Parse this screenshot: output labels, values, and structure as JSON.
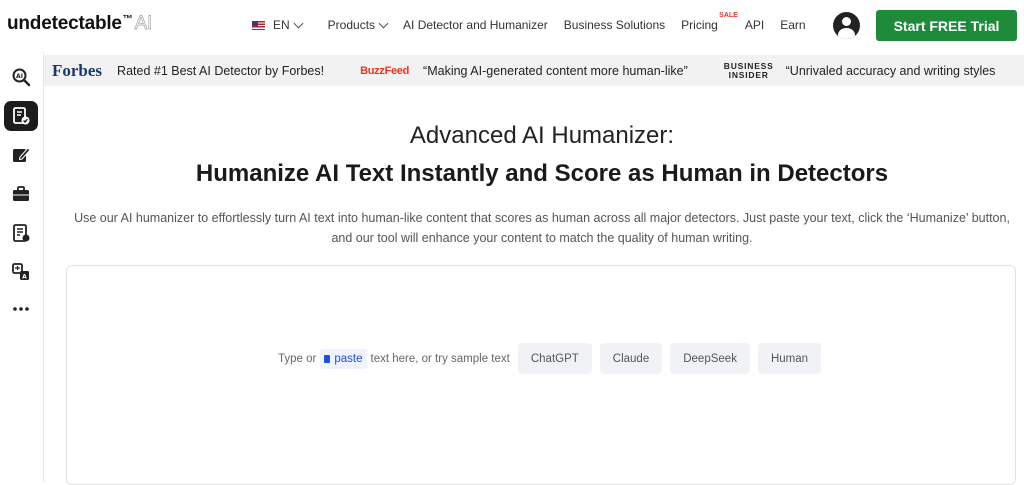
{
  "brand": {
    "name": "undetectable",
    "tm": "™",
    "ai": "AI"
  },
  "nav": {
    "language": "EN",
    "products": "Products",
    "detector": "AI Detector and Humanizer",
    "business": "Business Solutions",
    "pricing": "Pricing",
    "sale_badge": "SALE",
    "api": "API",
    "earn": "Earn",
    "cta": "Start FREE Trial"
  },
  "sidebar": [
    {
      "icon": "ai-detector-icon"
    },
    {
      "icon": "humanizer-icon",
      "active": true
    },
    {
      "icon": "writer-icon"
    },
    {
      "icon": "business-icon"
    },
    {
      "icon": "document-icon"
    },
    {
      "icon": "translate-icon"
    },
    {
      "icon": "more-icon"
    }
  ],
  "press": {
    "forbes_logo": "Forbes",
    "forbes_quote": "Rated #1 Best AI Detector by Forbes!",
    "buzzfeed_logo": "BuzzFeed",
    "buzzfeed_quote": "“Making AI-generated content more human-like”",
    "bi_logo_line1": "BUSINESS",
    "bi_logo_line2": "INSIDER",
    "bi_quote": "“Unrivaled accuracy and writing styles"
  },
  "main": {
    "title": "Advanced AI Humanizer:",
    "subtitle": "Humanize AI Text Instantly and Score as Human in Detectors",
    "description": "Use our AI humanizer to effortlessly turn AI text into human-like content that scores as human across all major detectors. Just paste your text, click the ‘Humanize’ button, and our tool will enhance your content to match the quality of human writing."
  },
  "editor": {
    "prompt_before": "Type or",
    "paste_label": "paste",
    "prompt_after": "text here, or try sample text",
    "samples": [
      "ChatGPT",
      "Claude",
      "DeepSeek",
      "Human"
    ]
  }
}
